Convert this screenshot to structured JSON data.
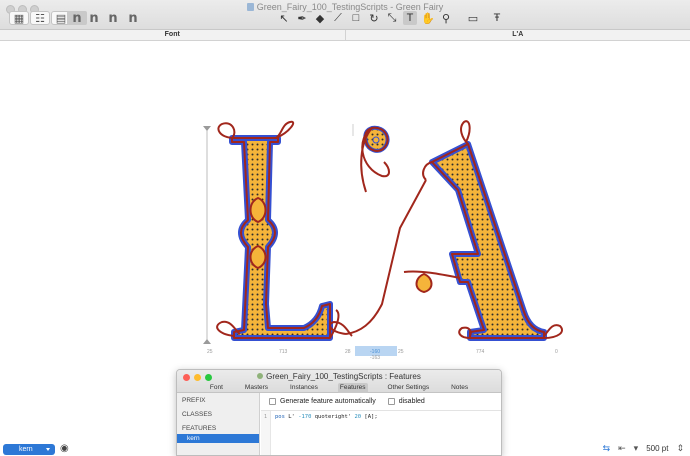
{
  "window": {
    "title": "Green_Fairy_100_TestingScripts - Green Fairy"
  },
  "toolbar": {
    "glyph_glyphs": [
      "n",
      "n",
      "n",
      "n"
    ],
    "tool_icons": [
      "select-tool-icon",
      "pen-tool-icon",
      "eraser-tool-icon",
      "knife-tool-icon",
      "rectangle-tool-icon",
      "rotate-tool-icon",
      "scale-tool-icon",
      "text-tool-icon",
      "hand-tool-icon",
      "zoom-tool-icon",
      "measure-tool-icon",
      "type-tool-icon"
    ]
  },
  "tabs": [
    "Font",
    "L'A"
  ],
  "metrics": {
    "labels": [
      "25",
      "713",
      "28",
      "-160",
      "25",
      "774",
      "0"
    ],
    "sublabel": "-163"
  },
  "features_panel": {
    "title": "Green_Fairy_100_TestingScripts : Features",
    "tabs": [
      "Font",
      "Masters",
      "Instances",
      "Features",
      "Other Settings",
      "Notes"
    ],
    "active_tab": "Features",
    "sidebar": {
      "prefix": "PREFIX",
      "classes": "CLASSES",
      "features": "FEATURES",
      "selected_feature": "kern"
    },
    "option_generate": "Generate feature automatically",
    "option_disabled": "disabled",
    "line_number": "1",
    "code": {
      "kw": "pos",
      "a": " L' ",
      "n1": "-170",
      "b": " quoteright' ",
      "n2": "20",
      "c": " [A];"
    }
  },
  "bottom": {
    "feature_button": "kern",
    "zoom": "500 pt"
  },
  "colors": {
    "fill": "#f5b43a",
    "dots": "#2b2b2b",
    "inner_stroke": "#3550d2",
    "outer_stroke": "#a1271c"
  }
}
